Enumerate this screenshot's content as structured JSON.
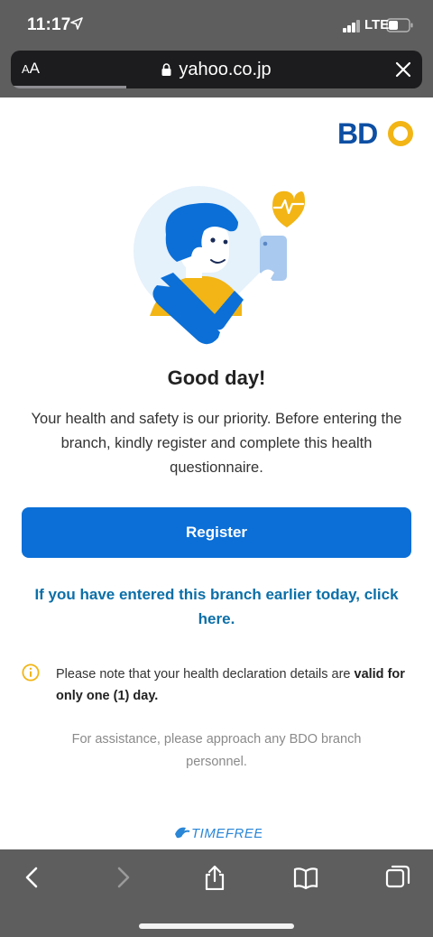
{
  "status_bar": {
    "time": "11:17",
    "network": "LTE"
  },
  "browser": {
    "text_size_small": "A",
    "text_size_large": "A",
    "domain": "yahoo.co.jp"
  },
  "page": {
    "logo_text": "BDO",
    "greeting": "Good day!",
    "intro": "Your health and safety is our priority. Before entering the branch, kindly register and complete this health questionnaire.",
    "register_label": "Register",
    "earlier_link": "If you have entered this branch earlier today, click here.",
    "note_prefix": "Please note that your health declaration details are ",
    "note_bold": "valid for only one (1) day.",
    "assistance": "For assistance, please approach any BDO branch personnel.",
    "footer_brand": "TIMEFREE"
  },
  "colors": {
    "chrome_gray": "#5e5e5e",
    "url_bar": "#1c1c1e",
    "primary_blue": "#0b6fd7",
    "link_blue": "#0b6fa8",
    "bdo_blue": "#0d4fa3",
    "bdo_gold": "#f2b515",
    "note_yellow": "#f2b515"
  },
  "icons": {
    "location": "location-arrow-icon",
    "lock": "lock-icon",
    "close": "close-icon",
    "info": "info-icon",
    "heart": "heartbeat-heart-icon",
    "back": "chevron-left-icon",
    "forward": "chevron-right-icon",
    "share": "share-icon",
    "bookmarks": "book-icon",
    "tabs": "tabs-icon"
  }
}
